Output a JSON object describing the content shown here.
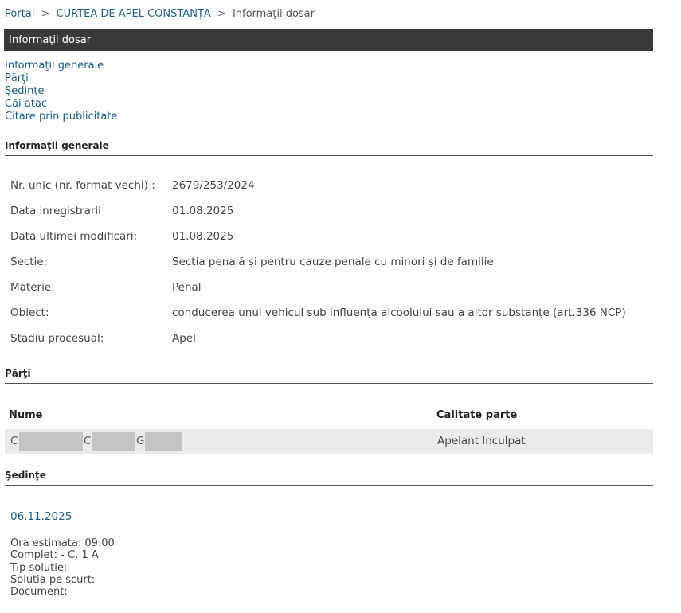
{
  "breadcrumb": {
    "items": [
      "Portal",
      "CURTEA DE APEL CONSTANȚA",
      "Informaţii dosar"
    ],
    "separator": ">"
  },
  "title_bar": {
    "label": "Informaţii dosar"
  },
  "quick_links": [
    "Informaţii generale",
    "Părţi",
    "Şedinţe",
    "Căi atac",
    "Citare prin publicitate"
  ],
  "sections": {
    "general": "Informaţii generale",
    "parti": "Părţi",
    "sedinte": "Şedinţe"
  },
  "general_info": [
    {
      "label": "Nr. unic (nr. format vechi) :",
      "value": "2679/253/2024"
    },
    {
      "label": "Data inregistrarii",
      "value": "01.08.2025"
    },
    {
      "label": "Data ultimei modificari:",
      "value": "01.08.2025"
    },
    {
      "label": "Sectie:",
      "value": "Sectia penală și pentru cauze penale cu minori și de familie"
    },
    {
      "label": "Materie:",
      "value": "Penal"
    },
    {
      "label": "Obiect:",
      "value": "conducerea unui vehicul sub influența alcoolului sau a altor substanțe (art.336 NCP)"
    },
    {
      "label": "Stadiu procesual:",
      "value": "Apel"
    }
  ],
  "parti": {
    "headers": {
      "name": "Nume",
      "role": "Calitate parte"
    },
    "rows": [
      {
        "initials": [
          "C",
          "C",
          "G"
        ],
        "role": "Apelant Inculpat"
      }
    ]
  },
  "sedinte": {
    "date": "06.11.2025",
    "details": [
      "Ora estimata: 09:00",
      "Complet: - C. 1 A",
      "Tip solutie:",
      "Solutia pe scurt:",
      "Document:"
    ]
  },
  "colors": {
    "link": "#1a5f8f",
    "title_bar_bg": "#3a3a3a",
    "row_bg": "#ebebeb",
    "redaction": "#c4c4c4"
  }
}
